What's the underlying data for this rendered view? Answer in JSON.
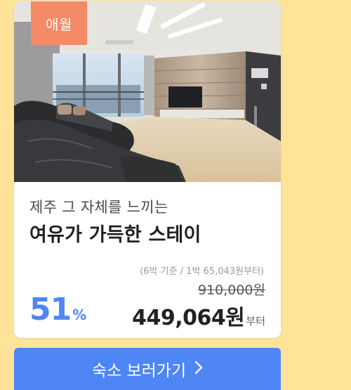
{
  "card": {
    "region_badge": "애월",
    "subtitle": "제주 그 자체를 느끼는",
    "title": "여유가 가득한 스테이",
    "price_basis": "(6박 기준 / 1박 65,043원부터)",
    "original_price": "910,000원",
    "discount": {
      "value": "51",
      "unit": "%"
    },
    "price": {
      "amount": "449,064원",
      "suffix": "부터"
    }
  },
  "cta": {
    "label": "숙소 보러가기",
    "icon": "chevron-right-icon"
  },
  "colors": {
    "background": "#ffe399",
    "badge": "#f48a66",
    "accent": "#4e86f6"
  }
}
